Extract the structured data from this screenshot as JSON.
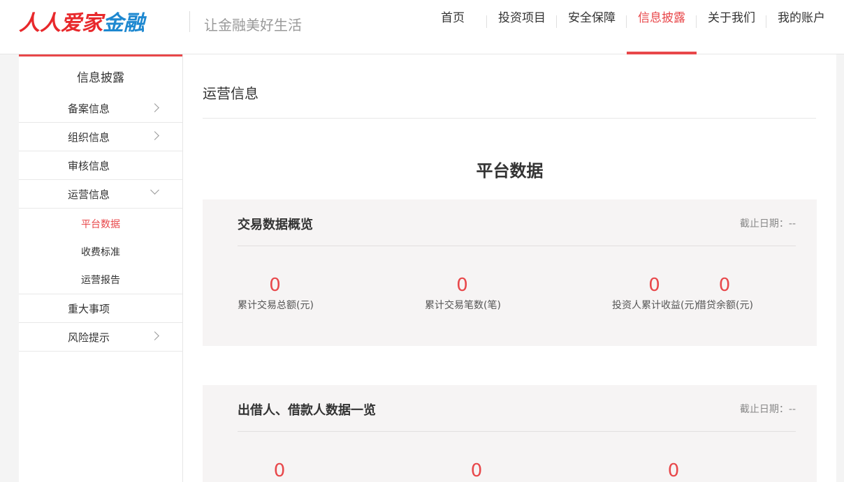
{
  "header": {
    "logo_red": "人人爱家",
    "logo_blue": "金融",
    "slogan": "让金融美好生活",
    "nav": [
      {
        "label": "首页"
      },
      {
        "label": "投资项目"
      },
      {
        "label": "安全保障"
      },
      {
        "label": "信息披露",
        "active": true
      },
      {
        "label": "关于我们"
      },
      {
        "label": "我的账户"
      }
    ]
  },
  "sidebar": {
    "title": "信息披露",
    "items": [
      {
        "label": "备案信息",
        "icon": "chevron-right-icon"
      },
      {
        "label": "组织信息",
        "icon": "chevron-right-icon"
      },
      {
        "label": "审核信息"
      },
      {
        "label": "运营信息",
        "icon": "chevron-down-icon"
      },
      {
        "label": "重大事项"
      },
      {
        "label": "风险提示",
        "icon": "chevron-right-icon"
      }
    ],
    "sub_items": [
      {
        "label": "平台数据",
        "active": true
      },
      {
        "label": "收费标准"
      },
      {
        "label": "运营报告"
      }
    ]
  },
  "main": {
    "heading": "运营信息",
    "section_title": "平台数据",
    "panels": [
      {
        "title": "交易数据概览",
        "date_label": "截止日期：--",
        "stats": [
          {
            "value": "0",
            "label": "累计交易总额(元)"
          },
          {
            "value": "0",
            "label": "累计交易笔数(笔)"
          },
          {
            "value": "0",
            "label": "投资人累计收益(元)"
          },
          {
            "value": "0",
            "label": "借贷余额(元)"
          }
        ]
      },
      {
        "title": "出借人、借款人数据一览",
        "date_label": "截止日期：--",
        "stats": [
          {
            "value": "0"
          },
          {
            "value": "0"
          },
          {
            "value": "0"
          }
        ]
      }
    ]
  },
  "colors": {
    "accent": "#e8474a",
    "logo_blue": "#1e88d0",
    "panel_bg": "#f6f4f4"
  }
}
